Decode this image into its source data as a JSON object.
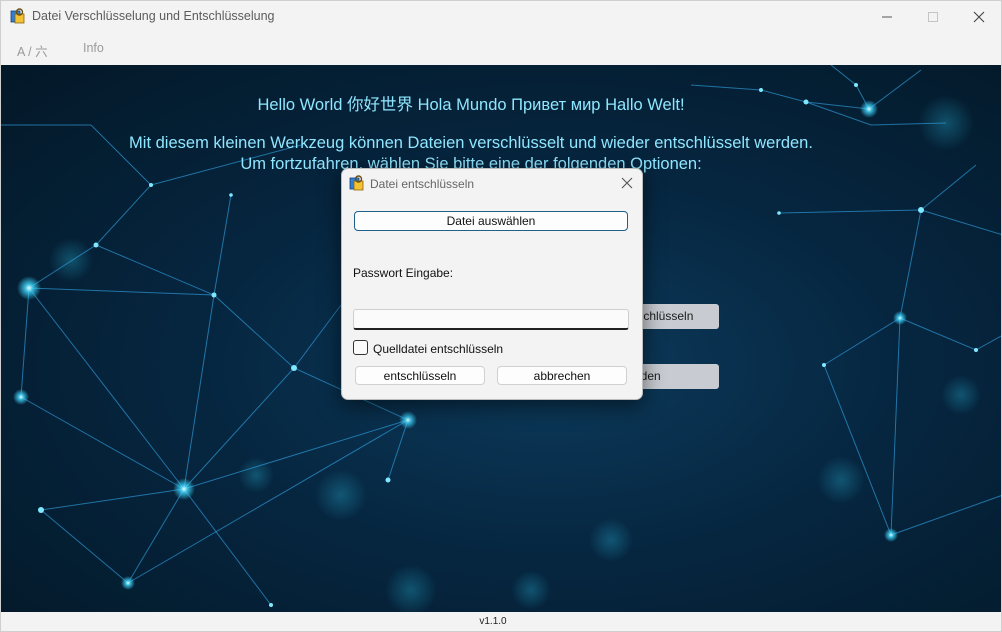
{
  "window": {
    "title": "Datei Verschlüsselung und Entschlüsselung"
  },
  "menu": {
    "items": [
      "A / 六",
      "Info"
    ]
  },
  "main": {
    "hello": "Hello World 你好世界 Hola Mundo Привет мир Hallo Welt!",
    "intro_line1": "Mit diesem kleinen Werkzeug können Dateien verschlüsselt und wieder entschlüsselt werden.",
    "intro_line2": "Um fortzufahren, wählen Sie bitte eine der folgenden Optionen:",
    "button1_partial": "tschlüsseln",
    "button2_partial": "nden"
  },
  "dialog": {
    "title": "Datei entschlüsseln",
    "select_file_label": "Datei auswählen",
    "password_label": "Passwort Eingabe:",
    "password_value": "",
    "checkbox_label": "Quelldatei entschlüsseln",
    "checkbox_checked": false,
    "decrypt_label": "entschlüsseln",
    "cancel_label": "abbrechen"
  },
  "status": {
    "version": "v1.1.0"
  },
  "colors": {
    "text_accent": "#8fe6ff",
    "background_dark": "#062640",
    "dialog_border_accent": "#1f5f8a"
  }
}
